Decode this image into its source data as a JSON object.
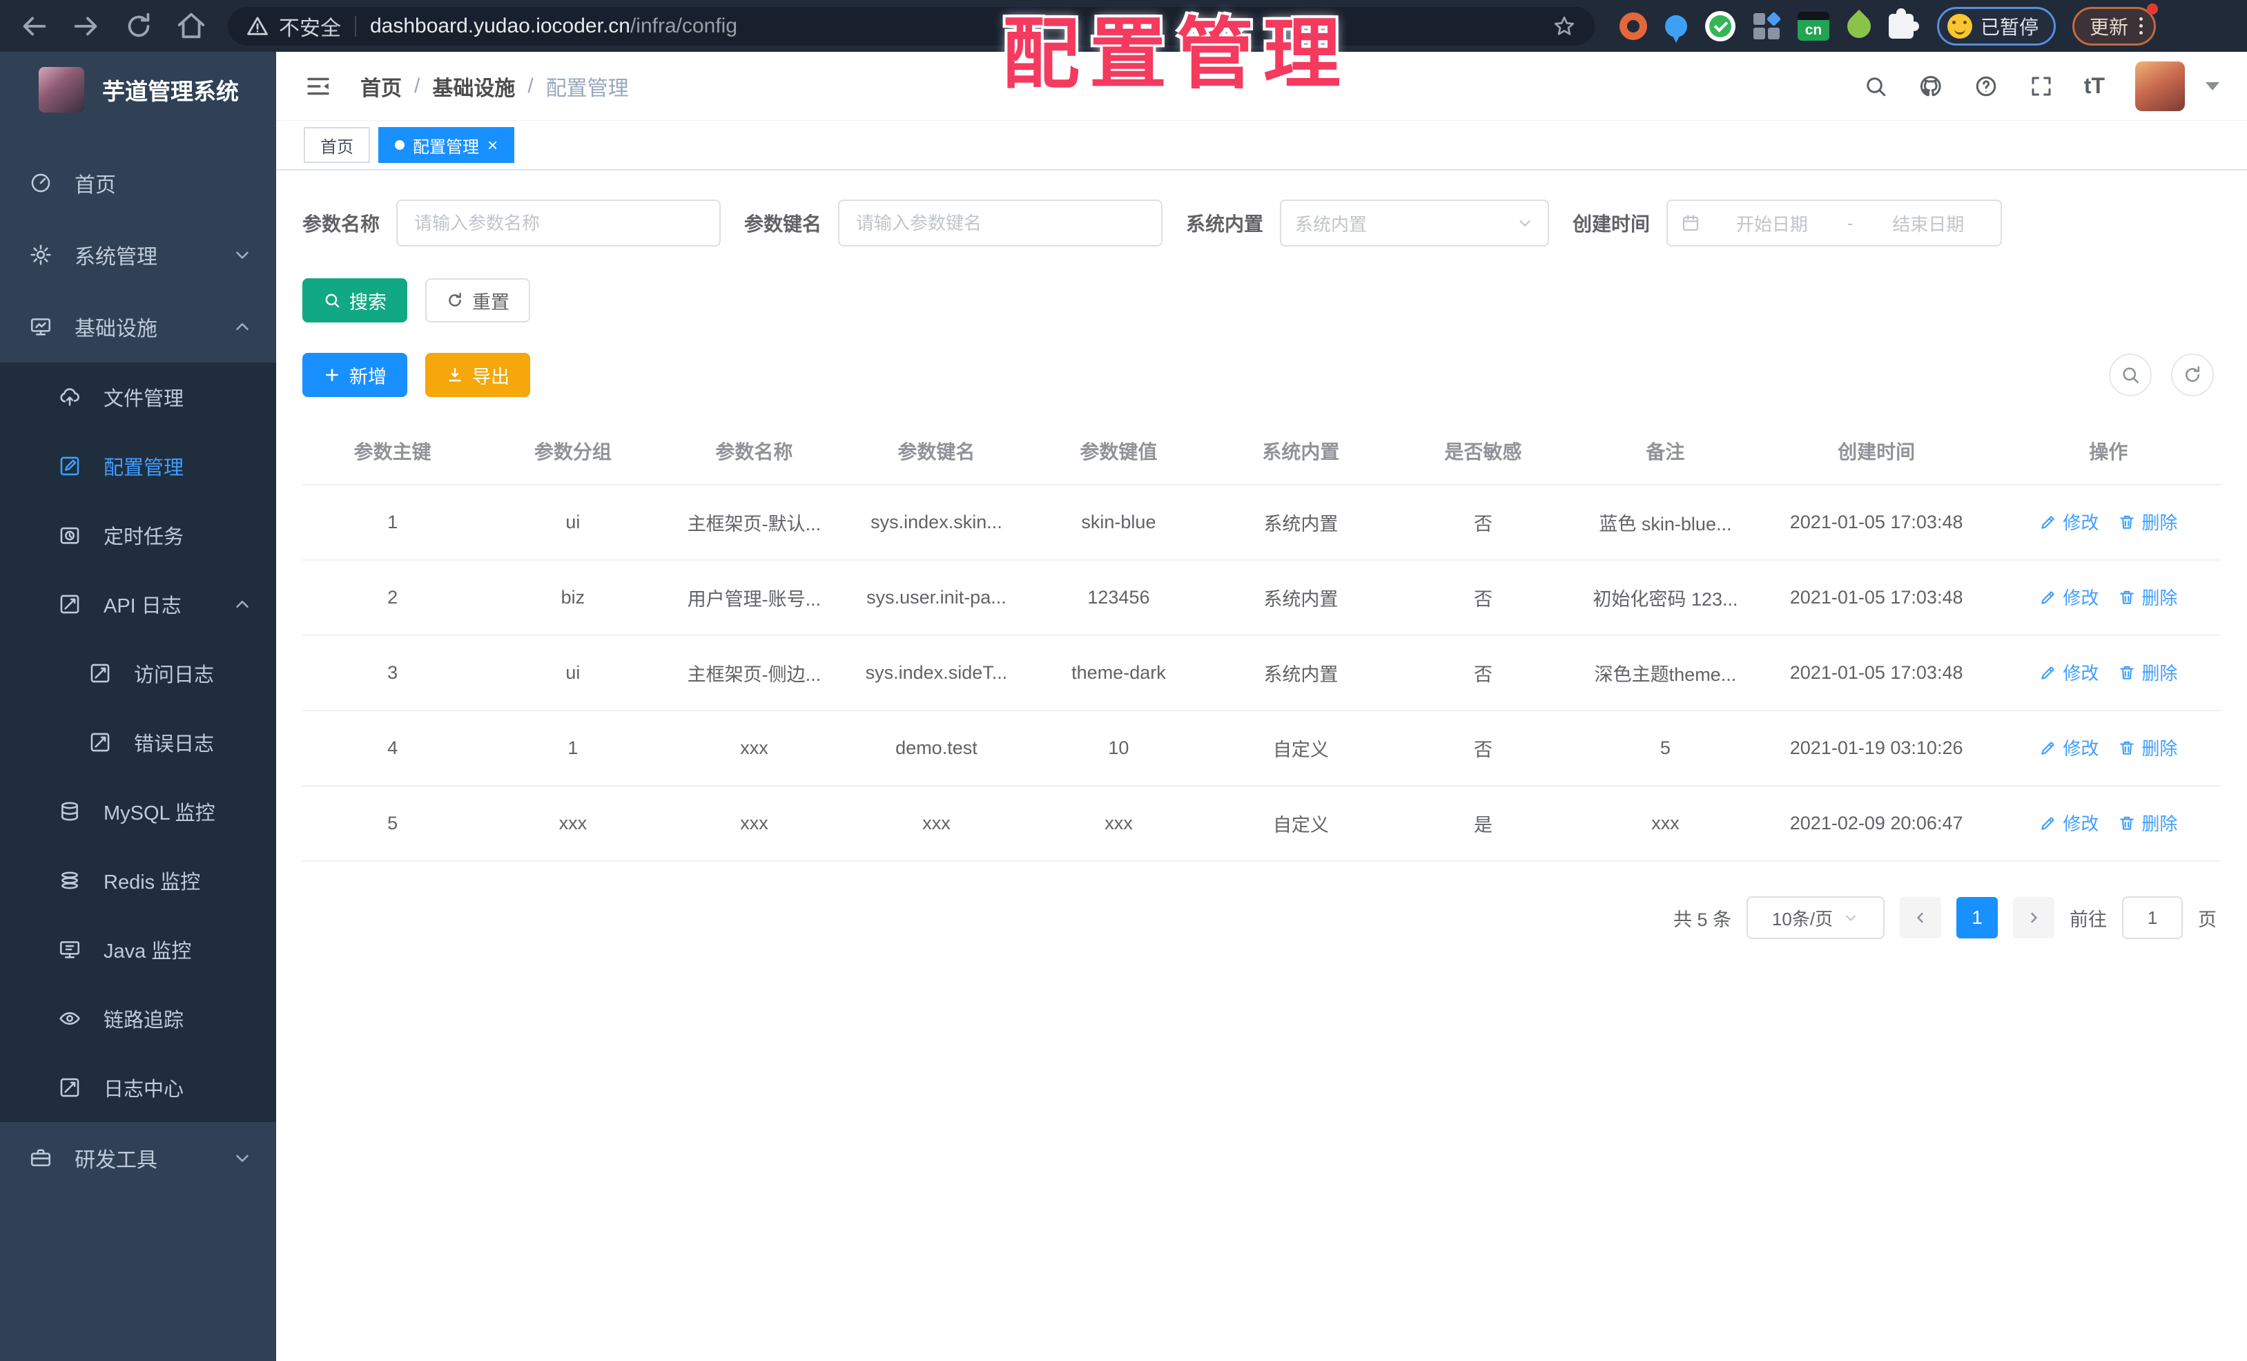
{
  "browser": {
    "security_label": "不安全",
    "url_host": "dashboard.yudao.iocoder.cn",
    "url_path": "/infra/config",
    "extension_cn_label": "cn",
    "paused_badge_label": "已暂停",
    "update_button_label": "更新"
  },
  "watermark": {
    "text": "配置管理",
    "color": "#f43a5e"
  },
  "sidebar": {
    "title": "芋道管理系统",
    "menu": [
      {
        "label": "首页"
      },
      {
        "label": "系统管理"
      },
      {
        "label": "基础设施"
      },
      {
        "label": "文件管理"
      },
      {
        "label": "配置管理"
      },
      {
        "label": "定时任务"
      },
      {
        "label": "API 日志"
      },
      {
        "label": "访问日志"
      },
      {
        "label": "错误日志"
      },
      {
        "label": "MySQL 监控"
      },
      {
        "label": "Redis 监控"
      },
      {
        "label": "Java 监控"
      },
      {
        "label": "链路追踪"
      },
      {
        "label": "日志中心"
      },
      {
        "label": "研发工具"
      }
    ]
  },
  "header": {
    "breadcrumb": [
      "首页",
      "基础设施",
      "配置管理"
    ],
    "breadcrumb_separator": "/"
  },
  "tabbar": {
    "tabs": [
      {
        "label": "首页",
        "active": false
      },
      {
        "label": "配置管理",
        "active": true
      }
    ],
    "close_glyph": "×"
  },
  "filters": {
    "name_label": "参数名称",
    "name_placeholder": "请输入参数名称",
    "key_label": "参数键名",
    "key_placeholder": "请输入参数键名",
    "type_label": "系统内置",
    "type_placeholder": "系统内置",
    "date_label": "创建时间",
    "date_start_placeholder": "开始日期",
    "date_separator": "-",
    "date_end_placeholder": "结束日期",
    "search_label": "搜索",
    "reset_label": "重置"
  },
  "toolbar": {
    "add_label": "新增",
    "export_label": "导出"
  },
  "table": {
    "columns": [
      "参数主键",
      "参数分组",
      "参数名称",
      "参数键名",
      "参数键值",
      "系统内置",
      "是否敏感",
      "备注",
      "创建时间",
      "操作"
    ],
    "rows": [
      [
        "1",
        "ui",
        "主框架页-默认...",
        "sys.index.skin...",
        "skin-blue",
        "系统内置",
        "否",
        "蓝色 skin-blue...",
        "2021-01-05 17:03:48"
      ],
      [
        "2",
        "biz",
        "用户管理-账号...",
        "sys.user.init-pa...",
        "123456",
        "系统内置",
        "否",
        "初始化密码 123...",
        "2021-01-05 17:03:48"
      ],
      [
        "3",
        "ui",
        "主框架页-侧边...",
        "sys.index.sideT...",
        "theme-dark",
        "系统内置",
        "否",
        "深色主题theme...",
        "2021-01-05 17:03:48"
      ],
      [
        "4",
        "1",
        "xxx",
        "demo.test",
        "10",
        "自定义",
        "否",
        "5",
        "2021-01-19 03:10:26"
      ],
      [
        "5",
        "xxx",
        "xxx",
        "xxx",
        "xxx",
        "自定义",
        "是",
        "xxx",
        "2021-02-09 20:06:47"
      ]
    ],
    "edit_label": "修改",
    "delete_label": "删除"
  },
  "pagination": {
    "total_label": "共 5 条",
    "page_size_label": "10条/页",
    "current_page": "1",
    "goto_label": "前往",
    "goto_value": "1",
    "page_unit_label": "页"
  },
  "colors": {
    "accent_blue": "#1890ff",
    "menu_active_blue": "#409eff",
    "search_teal": "#11a983",
    "export_yellow": "#f5a70b",
    "watermark_red": "#f43a5e",
    "sidebar_bg": "#304156",
    "sidebar_submenu_bg": "#1f2d3d",
    "chrome_bg": "#202a39"
  }
}
